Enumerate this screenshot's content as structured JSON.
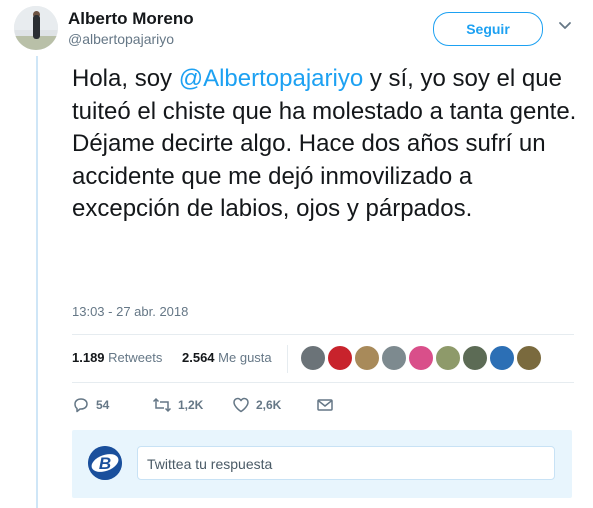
{
  "author": {
    "name": "Alberto Moreno",
    "handle": "@albertopajariyo",
    "avatar_icon": "user-avatar-photo"
  },
  "follow_button": {
    "label": "Seguir"
  },
  "menu_icon": "chevron-down-icon",
  "tweet": {
    "line1_prefix": "Hola, soy ",
    "mention": "@Albertopajariyo",
    "line1_suffix": " y sí, yo soy el que tuiteó el chiste que ha molestado a tanta gente.",
    "line2": "Déjame decirte algo. Hace dos años sufrí un accidente que me dejó inmovilizado a excepción de labios, ojos y párpados."
  },
  "timestamp": "13:03 - 27 abr. 2018",
  "stats": {
    "retweets_count": "1.189",
    "retweets_label": "Retweets",
    "likes_count": "2.564",
    "likes_label": "Me gusta"
  },
  "likers": [
    {
      "icon": "liker-avatar-1",
      "color": "#6b7378"
    },
    {
      "icon": "liker-avatar-2",
      "color": "#c8232c"
    },
    {
      "icon": "liker-avatar-3",
      "color": "#a88a5a"
    },
    {
      "icon": "liker-avatar-4",
      "color": "#7d8a8f"
    },
    {
      "icon": "liker-avatar-5",
      "color": "#d94f8a"
    },
    {
      "icon": "liker-avatar-6",
      "color": "#8e9a6a"
    },
    {
      "icon": "liker-avatar-7",
      "color": "#5c6b55"
    },
    {
      "icon": "liker-avatar-8",
      "color": "#2c6fb5"
    },
    {
      "icon": "liker-avatar-9",
      "color": "#7a6a3e"
    }
  ],
  "actions": {
    "replies": "54",
    "retweets": "1,2K",
    "likes": "2,6K"
  },
  "reply": {
    "placeholder": "Twittea tu respuesta",
    "avatar_icon": "bleacher-logo-avatar"
  },
  "colors": {
    "accent": "#1da1f2",
    "text": "#14171a",
    "secondary": "#657786"
  }
}
